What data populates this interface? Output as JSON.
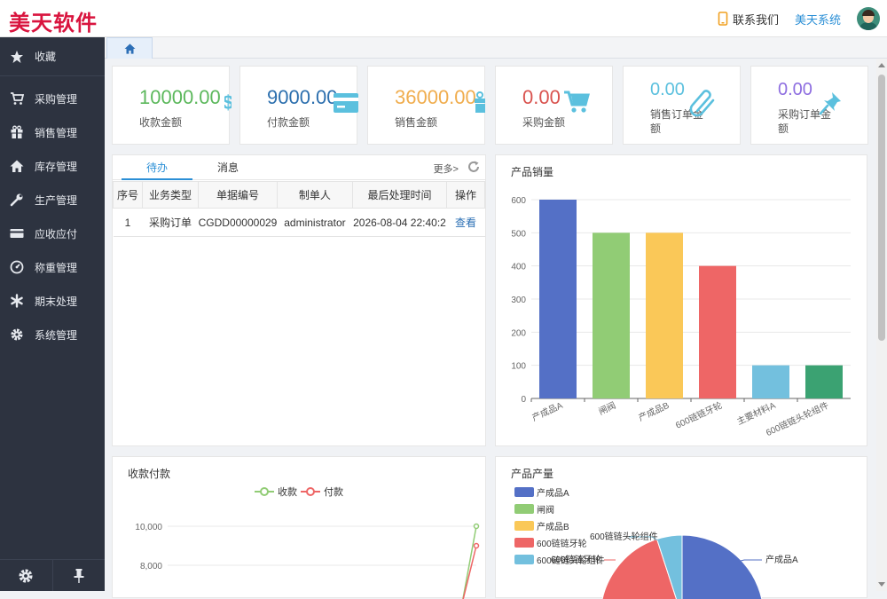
{
  "header": {
    "logo": "美天软件",
    "contact": "联系我们",
    "system": "美天系统"
  },
  "sidebar": {
    "fav": "收藏",
    "items": [
      "采购管理",
      "销售管理",
      "库存管理",
      "生产管理",
      "应收应付",
      "称重管理",
      "期末处理",
      "系统管理"
    ]
  },
  "stats": [
    {
      "value": "10000.00",
      "label": "收款金额",
      "color": "#5cb85c"
    },
    {
      "value": "9000.00",
      "label": "付款金额",
      "color": "#2c6fae"
    },
    {
      "value": "36000.00",
      "label": "销售金额",
      "color": "#f0ad4e"
    },
    {
      "value": "0.00",
      "label": "采购金额",
      "color": "#d9534f"
    },
    {
      "value": "0.00",
      "label": "销售订单金额",
      "color": "#5bc0de"
    },
    {
      "value": "0.00",
      "label": "采购订单金额",
      "color": "#8e6ee0"
    }
  ],
  "tasks": {
    "tabs": [
      "待办",
      "消息"
    ],
    "more": "更多>",
    "columns": [
      "序号",
      "业务类型",
      "单据编号",
      "制单人",
      "最后处理时间",
      "操作"
    ],
    "rows": [
      [
        "1",
        "采购订单",
        "CGDD00000029",
        "administrator",
        "2026-08-04 22:40:2",
        "查看"
      ]
    ]
  },
  "sales_panel": {
    "title": "产品销量"
  },
  "cash_panel": {
    "title": "收款付款"
  },
  "output_panel": {
    "title": "产品产量"
  },
  "chart_data": [
    {
      "type": "bar",
      "title": "产品销量",
      "categories": [
        "产成品A",
        "闸阀",
        "产成品B",
        "600链链牙轮",
        "主要材料A",
        "600链链头轮组件"
      ],
      "values": [
        600,
        500,
        500,
        400,
        100,
        100
      ],
      "colors": [
        "#5470c6",
        "#91cc75",
        "#fac858",
        "#ee6666",
        "#73c0de",
        "#3ba272"
      ],
      "ylim": [
        0,
        600
      ],
      "yticks": [
        0,
        100,
        200,
        300,
        400,
        500,
        600
      ]
    },
    {
      "type": "line",
      "title": "收款付款",
      "series": [
        {
          "name": "收款",
          "color": "#91cc75",
          "last": 10000
        },
        {
          "name": "付款",
          "color": "#ee6666",
          "last": 9000
        }
      ],
      "yticks_visible": [
        "10,000",
        "8,000"
      ]
    },
    {
      "type": "pie",
      "title": "产品产量",
      "legend": [
        "产成品A",
        "闸阀",
        "产成品B",
        "600链链牙轮",
        "600链链头轮组件"
      ],
      "colors": [
        "#5470c6",
        "#91cc75",
        "#fac858",
        "#ee6666",
        "#73c0de"
      ],
      "slice_labels": [
        "600链链头轮组件",
        "产成品A",
        "600链链牙轮"
      ]
    }
  ]
}
